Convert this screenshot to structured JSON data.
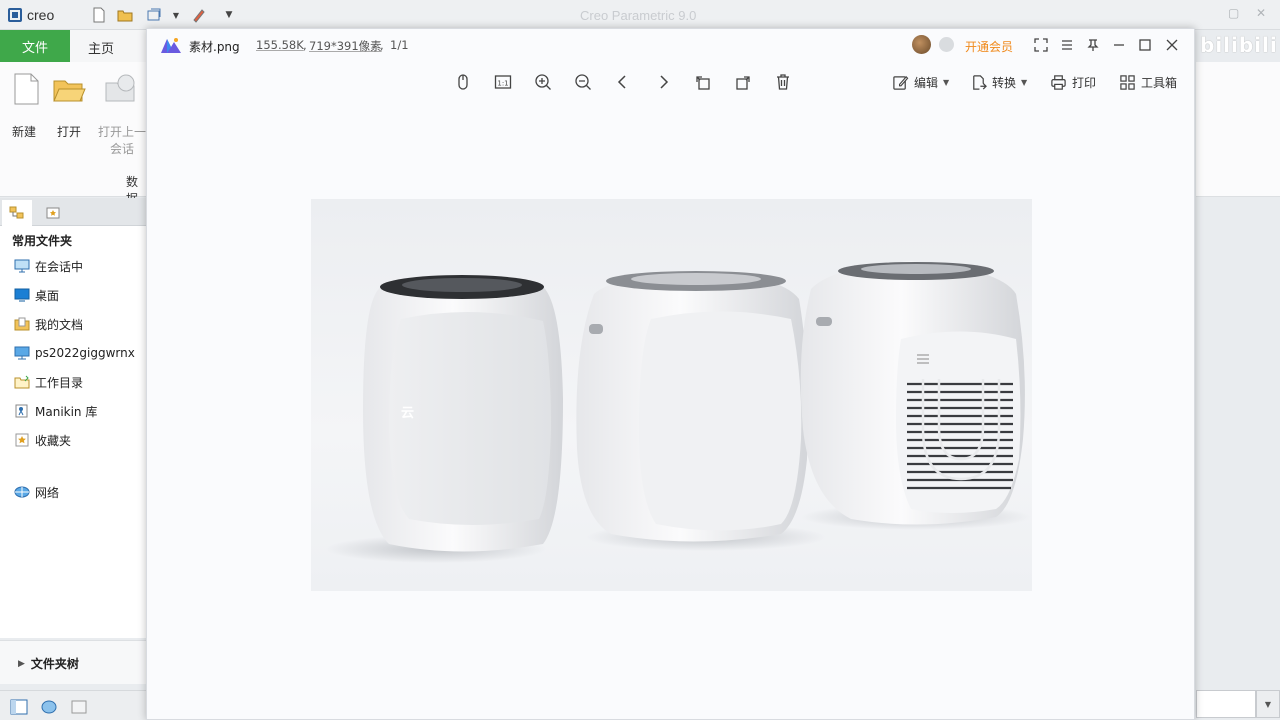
{
  "creo": {
    "logo_text": "creo",
    "window_title": "Creo Parametric 9.0",
    "tabs": {
      "file": "文件",
      "home": "主页"
    },
    "ribbon": {
      "new_label": "新建",
      "open_label": "打开",
      "open_last_line1": "打开上一",
      "open_last_line2": "会话",
      "group_label": "数据"
    },
    "navigator": {
      "heading": "常用文件夹",
      "items": [
        {
          "label": "在会话中",
          "icon": "monitor-icon"
        },
        {
          "label": "桌面",
          "icon": "desktop-icon"
        },
        {
          "label": "我的文档",
          "icon": "documents-icon"
        },
        {
          "label": "ps2022giggwrnx",
          "icon": "computer-icon"
        },
        {
          "label": "工作目录",
          "icon": "working-folder-icon"
        },
        {
          "label": "Manikin 库",
          "icon": "manikin-library-icon"
        },
        {
          "label": "收藏夹",
          "icon": "favorites-icon"
        },
        {
          "label": "网络",
          "icon": "network-icon"
        }
      ],
      "folder_tree": "文件夹树"
    },
    "watermark": "bilibili"
  },
  "viewer": {
    "file_name": "素材.png",
    "file_size": "155.58K",
    "dimensions": "719*391像素",
    "page": "1/1",
    "vip_label": "开通会员",
    "toolbar": {
      "edit": "编辑",
      "convert": "转换",
      "print": "打印",
      "toolbox": "工具箱"
    },
    "image_logo_text": "云"
  },
  "colors": {
    "file_tab": "#3fa84a",
    "vip_orange": "#f08a1c",
    "accent_blue": "#2a5d9a"
  }
}
